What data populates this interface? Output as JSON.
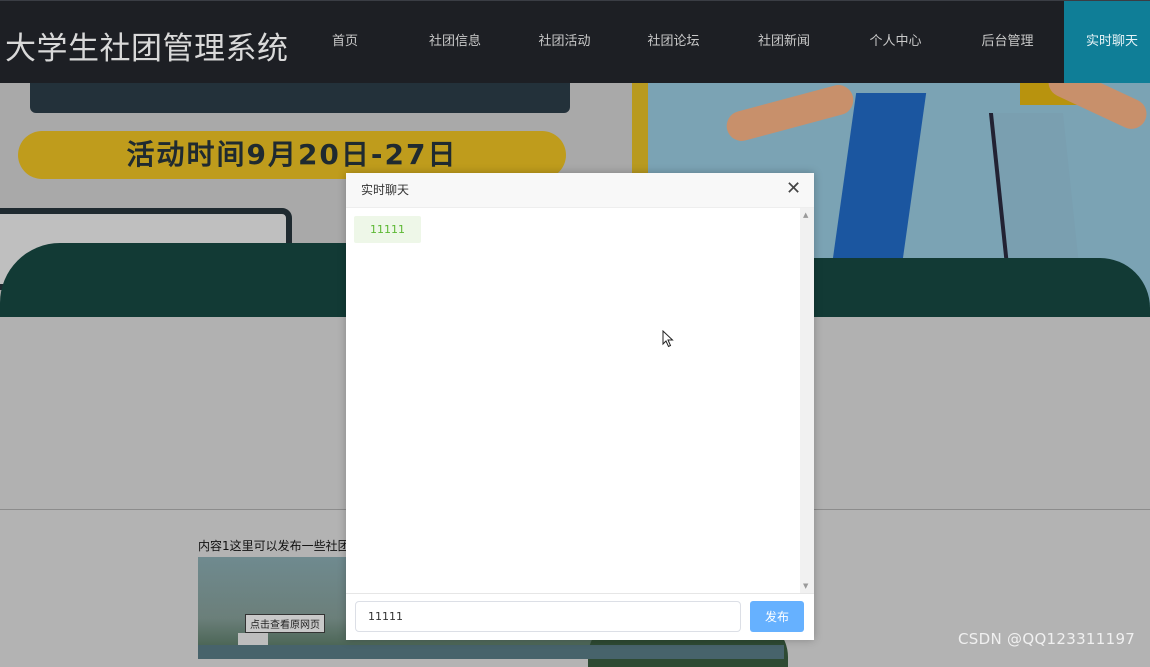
{
  "header": {
    "site_title": "大学生社团管理系统",
    "nav": [
      {
        "label": "首页",
        "active": false
      },
      {
        "label": "社团信息",
        "active": false
      },
      {
        "label": "社团活动",
        "active": false
      },
      {
        "label": "社团论坛",
        "active": false
      },
      {
        "label": "社团新闻",
        "active": false
      },
      {
        "label": "个人中心",
        "active": false
      },
      {
        "label": "后台管理",
        "active": false
      },
      {
        "label": "实时聊天",
        "active": true
      }
    ]
  },
  "banner": {
    "date_text": "活动时间9月20日-27日"
  },
  "content": {
    "text": "内容1这里可以发布一些社团",
    "image_button": "点击查看原网页"
  },
  "chat_dialog": {
    "title": "实时聊天",
    "close_icon": "close-icon",
    "messages": [
      "11111"
    ],
    "input_value": "11111",
    "send_label": "发布"
  },
  "watermark": "CSDN @QQ123311197",
  "colors": {
    "nav_active": "#0f7e97",
    "send_button": "#66b1ff",
    "message_text": "#5cb833"
  }
}
